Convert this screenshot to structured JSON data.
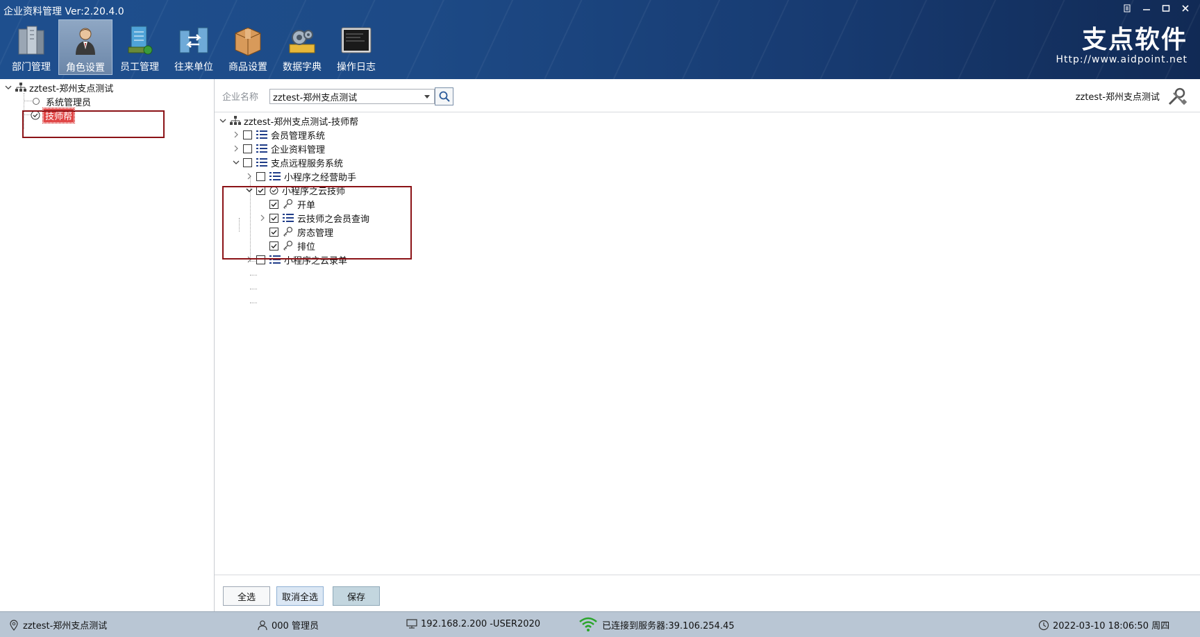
{
  "app": {
    "title": "企业资料管理 Ver:2.20.4.0",
    "brand_name": "支点软件",
    "brand_url": "Http://www.aidpoint.net"
  },
  "toolbar": [
    {
      "label": "部门管理",
      "icon": "department-icon"
    },
    {
      "label": "角色设置",
      "icon": "role-icon",
      "active": true
    },
    {
      "label": "员工管理",
      "icon": "employee-icon"
    },
    {
      "label": "往来单位",
      "icon": "partner-icon"
    },
    {
      "label": "商品设置",
      "icon": "product-icon"
    },
    {
      "label": "数据字典",
      "icon": "dictionary-icon"
    },
    {
      "label": "操作日志",
      "icon": "log-icon"
    }
  ],
  "role_tree": {
    "root": "zztest-郑州支点测试",
    "items": [
      "系统管理员",
      "技师帮"
    ],
    "selected": "技师帮"
  },
  "filter": {
    "label": "企业名称",
    "company_value": "zztest-郑州支点测试",
    "current_company": "zztest-郑州支点测试"
  },
  "perm_tree": {
    "root": "zztest-郑州支点测试-技师帮",
    "n1": "会员管理系统",
    "n2": "企业资料管理",
    "n3": "支点远程服务系统",
    "n3_1": "小程序之经营助手",
    "n3_2": "小程序之云技师",
    "n3_2_1": "开单",
    "n3_2_2": "云技师之会员查询",
    "n3_2_3": "房态管理",
    "n3_2_4": "排位",
    "n3_3": "小程序之云录单"
  },
  "buttons": {
    "select_all": "全选",
    "deselect_all": "取消全选",
    "save": "保存"
  },
  "status": {
    "location": "zztest-郑州支点测试",
    "user": "000 管理员",
    "machine": "192.168.2.200 -USER2020",
    "server": "已连接到服务器:39.106.254.45",
    "datetime": "2022-03-10 18:06:50 周四"
  },
  "colors": {
    "header": "#1d4a86",
    "status_bar": "#b9c6d4",
    "highlight_box": "#8b1216",
    "selection": "#e04545",
    "wifi": "#2aa52a"
  }
}
